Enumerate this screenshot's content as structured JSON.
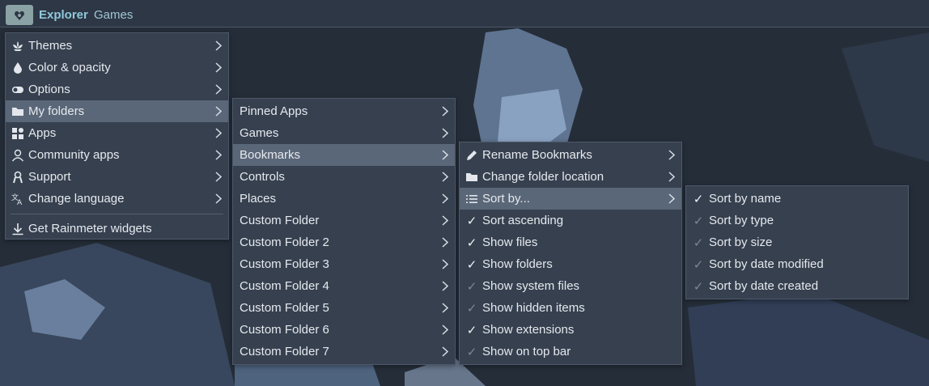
{
  "topbar": {
    "title": "Explorer",
    "item": "Games"
  },
  "menus": {
    "main": [
      {
        "label": "Themes",
        "icon": "lotus-icon"
      },
      {
        "label": "Color & opacity",
        "icon": "drop-icon"
      },
      {
        "label": "Options",
        "icon": "toggle-icon"
      },
      {
        "label": "My folders",
        "icon": "folder-icon"
      },
      {
        "label": "Apps",
        "icon": "apps-icon"
      },
      {
        "label": "Community apps",
        "icon": "person-icon"
      },
      {
        "label": "Support",
        "icon": "ribbon-icon"
      },
      {
        "label": "Change language",
        "icon": "translate-icon"
      },
      {
        "label": "Get Rainmeter widgets",
        "icon": "download-icon"
      }
    ],
    "folders": [
      "Pinned Apps",
      "Games",
      "Bookmarks",
      "Controls",
      "Places",
      "Custom Folder",
      "Custom Folder 2",
      "Custom Folder 3",
      "Custom Folder 4",
      "Custom Folder 5",
      "Custom Folder 6",
      "Custom Folder 7"
    ],
    "bookmarks": [
      {
        "label": "Rename Bookmarks",
        "mark": "pencil-icon"
      },
      {
        "label": "Change folder location",
        "mark": "folder-icon"
      },
      {
        "label": "Sort by...",
        "mark": "list-icon"
      },
      {
        "label": "Sort ascending",
        "mark": "✓",
        "checked": true
      },
      {
        "label": "Show files",
        "mark": "✓",
        "checked": true
      },
      {
        "label": "Show folders",
        "mark": "✓",
        "checked": true
      },
      {
        "label": "Show system files",
        "mark": "✓",
        "checked": false
      },
      {
        "label": "Show hidden items",
        "mark": "✓",
        "checked": false
      },
      {
        "label": "Show extensions",
        "mark": "✓",
        "checked": true
      },
      {
        "label": "Show on top bar",
        "mark": "✓",
        "checked": false
      }
    ],
    "sort": [
      {
        "label": "Sort by name",
        "mark": "✓",
        "checked": true
      },
      {
        "label": "Sort by type",
        "mark": "✓",
        "checked": false
      },
      {
        "label": "Sort by size",
        "mark": "✓",
        "checked": false
      },
      {
        "label": "Sort by date modified",
        "mark": "✓",
        "checked": false
      },
      {
        "label": "Sort by date created",
        "mark": "✓",
        "checked": false
      }
    ]
  },
  "colors": {
    "menu_bg": "#36404f",
    "active_bg": "#5a6778",
    "accent": "#8ec9dc"
  }
}
